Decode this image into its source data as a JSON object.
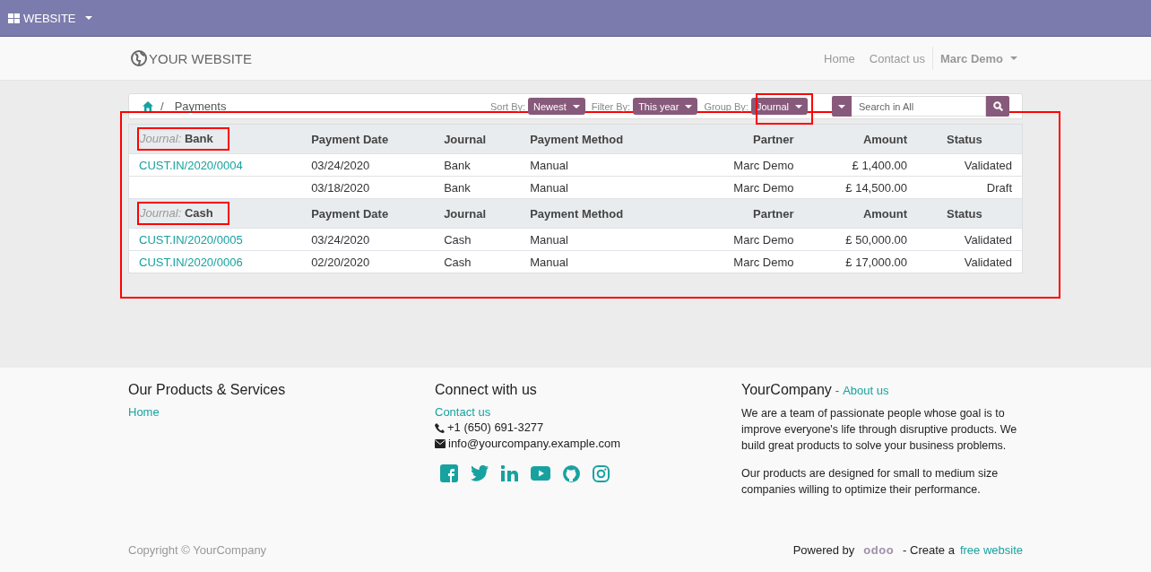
{
  "admin_bar": {
    "label": "WEBSITE"
  },
  "header": {
    "logo": "YOUR WEBSITE",
    "nav": [
      {
        "label": "Home"
      },
      {
        "label": "Contact us"
      }
    ],
    "user": "Marc Demo"
  },
  "toolbar": {
    "separator": "/",
    "breadcrumb": "Payments",
    "controls": [
      {
        "label": "Sort By:",
        "value": "Newest",
        "highlight": false
      },
      {
        "label": "Filter By:",
        "value": "This year",
        "highlight": false
      },
      {
        "label": "Group By:",
        "value": "Journal",
        "highlight": true
      }
    ],
    "search": {
      "placeholder": "Search in All"
    }
  },
  "table": {
    "highlight": true,
    "groups": [
      {
        "label": "Journal:",
        "value": "Bank",
        "highlight": true,
        "columns": [
          "Payment Date",
          "Journal",
          "Payment Method",
          "Partner",
          "Amount",
          "Status"
        ],
        "rows": [
          {
            "ref": "CUST.IN/2020/0004",
            "cells": [
              "03/24/2020",
              "Bank",
              "Manual",
              "Marc Demo",
              "£ 1,400.00",
              "Validated"
            ]
          },
          {
            "ref": "",
            "cells": [
              "03/18/2020",
              "Bank",
              "Manual",
              "Marc Demo",
              "£ 14,500.00",
              "Draft"
            ]
          }
        ]
      },
      {
        "label": "Journal:",
        "value": "Cash",
        "highlight": true,
        "columns": [
          "Payment Date",
          "Journal",
          "Payment Method",
          "Partner",
          "Amount",
          "Status"
        ],
        "rows": [
          {
            "ref": "CUST.IN/2020/0005",
            "cells": [
              "03/24/2020",
              "Cash",
              "Manual",
              "Marc Demo",
              "£ 50,000.00",
              "Validated"
            ]
          },
          {
            "ref": "CUST.IN/2020/0006",
            "cells": [
              "02/20/2020",
              "Cash",
              "Manual",
              "Marc Demo",
              "£ 17,000.00",
              "Validated"
            ]
          }
        ]
      }
    ]
  },
  "footer": {
    "col1": {
      "title": "Our Products & Services",
      "link": "Home"
    },
    "col2": {
      "title": "Connect with us",
      "link": "Contact us",
      "phone": "+1 (650) 691-3277",
      "email": "info@yourcompany.example.com"
    },
    "col3": {
      "title": "YourCompany",
      "sep": "-",
      "link": "About us",
      "paragraphs": [
        "We are a team of passionate people whose goal is to improve everyone's life through disruptive products. We build great products to solve your business problems.",
        "Our products are designed for small to medium size companies willing to optimize their performance."
      ]
    },
    "copyright": "Copyright © YourCompany",
    "powered": "Powered by",
    "brand": "odoo",
    "create": "- Create a",
    "create_link": "free website"
  }
}
